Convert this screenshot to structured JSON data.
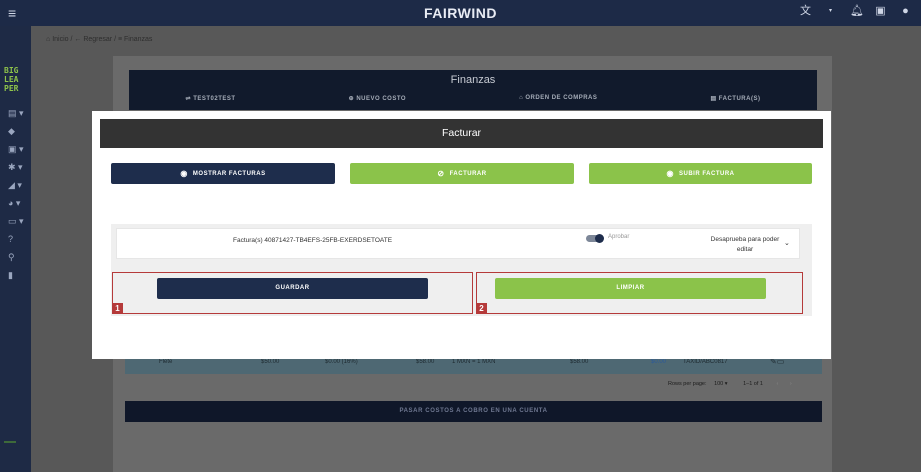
{
  "app": {
    "brand": "FAIRWIND",
    "logo_text": "BIG\nLEA\nPER"
  },
  "topbar_icons": [
    "translate-icon",
    "chevron-down-icon",
    "bell-icon",
    "chat-icon",
    "account-icon"
  ],
  "sidebar_icons": [
    "invoice-icon",
    "tag-icon",
    "id-card-icon",
    "person-icon",
    "truck-icon",
    "stopwatch-icon",
    "card-icon",
    "help-icon",
    "search-icon",
    "map-icon"
  ],
  "breadcrumb": {
    "home": "Inicio",
    "back": "Regresar",
    "current": "Finanzas"
  },
  "finanzas": {
    "title": "Finanzas",
    "tabs": [
      "TEST02TEST",
      "NUEVO COSTO",
      "ORDEN DE COMPRAS",
      "FACTURA(S)"
    ]
  },
  "table_row": [
    "Flete",
    "$50.00",
    "$0.00 (16%)",
    "$58.00",
    "1 MXN = 1 MXN",
    "$58.00",
    "$0.00",
    "TAXID/ABC0817"
  ],
  "pager": {
    "rows_label": "Rows per page:",
    "rows_value": "100",
    "range": "1–1 of 1",
    "prev": "‹",
    "next": "›"
  },
  "bottom_button": "PASAR COSTOS A COBRO EN UNA CUENTA",
  "modal": {
    "title": "Facturar",
    "buttons": {
      "mostrar": "MOSTRAR FACTURAS",
      "facturar": "FACTURAR",
      "subir": "SUBIR FACTURA"
    },
    "invoice_line": {
      "label": "Factura(s) 40871427-TB4EFS-25FB-EXERDSETOATE",
      "toggle_label": "Aprobar",
      "toggle_on": true,
      "desaprueba": "Desaprueba para poder editar"
    },
    "guardar": "GUARDAR",
    "limpiar": "LIMPIAR",
    "markers": [
      "1",
      "2"
    ]
  },
  "colors": {
    "navy": "#1e2d4c",
    "green": "#8bc34a",
    "marker": "#b53a3a"
  }
}
